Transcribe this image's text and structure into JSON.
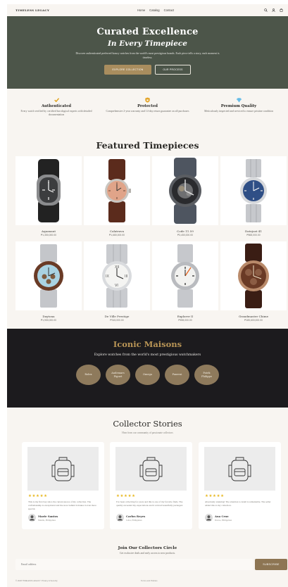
{
  "header": {
    "logo": "TIMELESS LEGACY",
    "nav": [
      "Home",
      "Catalog",
      "Contact"
    ]
  },
  "hero": {
    "title": "Curated Excellence",
    "subtitle": "In Every Timepiece",
    "description": "Discover authenticated preferred luxury watches from the world's most prestigious brands. Each piece tells a story, each moment is timeless.",
    "primary_button": "EXPLORE COLLECTION",
    "secondary_button": "OUR PROCESS"
  },
  "features": [
    {
      "icon": "check-icon",
      "title": "Authenticated",
      "text": "Every watch verified by certified horological experts with detailed documentation"
    },
    {
      "icon": "shield-icon",
      "title": "Protected",
      "text": "Comprehensive 2-year warranty and 14-day return guarantee on all purchases"
    },
    {
      "icon": "diamond-icon",
      "title": "Premium Quality",
      "text": "Meticulously inspected and serviced to ensure pristine condition"
    }
  ],
  "featured": {
    "title": "Featured Timepieces",
    "watches": [
      {
        "name": "Aquanaut",
        "price": "₱1,350,000.00"
      },
      {
        "name": "Calatrava",
        "price": "₱1,680,000.00"
      },
      {
        "name": "Code 11.59",
        "price": "₱3,450,000.00"
      },
      {
        "name": "Datejust 41",
        "price": "₱865,000.00"
      },
      {
        "name": "Daytona",
        "price": "₱1,950,000.00"
      },
      {
        "name": "De Ville Prestige",
        "price": "₱315,000.00"
      },
      {
        "name": "Explorer II",
        "price": "₱698,000.00"
      },
      {
        "name": "Grandmaster Chime",
        "price": "₱185,600,000.00"
      }
    ]
  },
  "maisons": {
    "title": "Iconic Maisons",
    "subtitle": "Explore watches from the world's most prestigious watchmakers",
    "brands": [
      {
        "line1": "Rolex",
        "line2": ""
      },
      {
        "line1": "Audemars",
        "line2": "Piguet"
      },
      {
        "line1": "Omega",
        "line2": ""
      },
      {
        "line1": "Panerai",
        "line2": ""
      },
      {
        "line1": "Patek",
        "line2": "Philippe"
      }
    ]
  },
  "stories": {
    "title": "Collector Stories",
    "subtitle": "Hear from our community of passionate collectors",
    "reviews": [
      {
        "stars": "★★★★★",
        "text": "This is my first buy since the current pieces of my collection. The craftsmanship is exceptional and the store behind it makes it even more special.",
        "name": "Marie Santos",
        "location": "Manila, Philippines"
      },
      {
        "stars": "★★★★★",
        "text": "I've been collecting for years and this is one of my favorite finds. The quality exceeded my expectations and it arrived beautifully packaged.",
        "name": "Carlos Reyes",
        "location": "Cebu, Philippines"
      },
      {
        "stars": "★★★★★",
        "text": "Absolutely stunning! The attention to detail is remarkable. The seller added this to my collection.",
        "name": "Ana Cruz",
        "location": "Davao, Philippines"
      }
    ]
  },
  "newsletter": {
    "title": "Join Our Collectors Circle",
    "subtitle": "Get exclusive deals and early access to new products.",
    "placeholder": "Email address",
    "button": "SUBSCRIBE"
  },
  "footer": {
    "copyright": "© 2026 TIMELESS LEGACY. Privacy & Security",
    "links": "Terms and Policies"
  }
}
